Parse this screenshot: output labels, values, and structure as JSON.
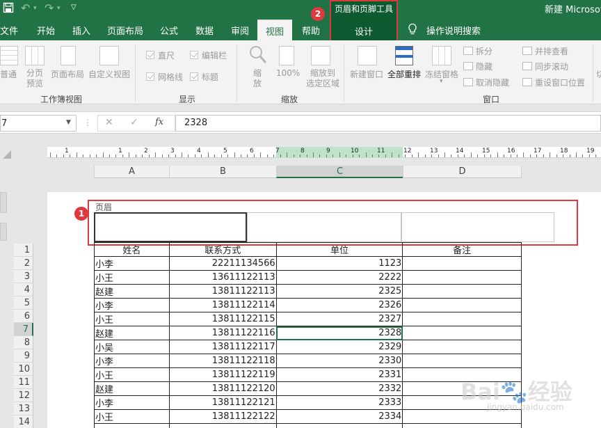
{
  "window": {
    "title": "新建 Microsof"
  },
  "quick_access": {
    "save_icon": "save-icon",
    "undo_icon": "undo-icon",
    "redo_icon": "redo-icon",
    "more": "▽"
  },
  "menu_tabs": [
    "文件",
    "开始",
    "插入",
    "页面布局",
    "公式",
    "数据",
    "审阅",
    "视图",
    "帮助"
  ],
  "active_tab": "视图",
  "context_group": {
    "title": "页眉和页脚工具",
    "tab": "设计"
  },
  "tell_me": {
    "text": "操作说明搜索",
    "icon": "lightbulb-icon"
  },
  "annotations": {
    "badge1": "1",
    "badge2": "2"
  },
  "ribbon": {
    "workbook_views": {
      "items": [
        "普通",
        "分页\n预览",
        "页面布局",
        "自定义视图"
      ],
      "name": "工作簿视图"
    },
    "show": {
      "items": [
        "直尺",
        "编辑栏",
        "网格线",
        "标题"
      ],
      "name": "显示"
    },
    "zoom": {
      "items": [
        "缩\n放",
        "100%",
        "缩放到\n选定区域"
      ],
      "name": "缩放"
    },
    "window": {
      "big": [
        "新建窗口",
        "全部重排",
        "冻结窗格"
      ],
      "small": [
        "拆分",
        "隐藏",
        "取消隐藏",
        "并排查看",
        "同步滚动",
        "重设窗口位置"
      ],
      "name": "窗口"
    },
    "cut_right": "切"
  },
  "formula_bar": {
    "name_box": "7",
    "fx": "fx",
    "cancel": "✕",
    "confirm": "✓",
    "formula": "2328"
  },
  "ruler_numbers": [
    "1",
    "1",
    "2",
    "3",
    "4",
    "5",
    "6",
    "7",
    "8",
    "9",
    "10",
    "11",
    "12",
    "13",
    "14",
    "15",
    "16",
    "17",
    "18",
    "19"
  ],
  "columns": [
    "A",
    "B",
    "C",
    "D"
  ],
  "header_section": {
    "label": "页眉"
  },
  "row_numbers": [
    "1",
    "2",
    "3",
    "4",
    "5",
    "6",
    "7",
    "8",
    "9",
    "10",
    "11",
    "12",
    "13",
    "14"
  ],
  "table": {
    "headers": [
      "姓名",
      "联系方式",
      "单位",
      "备注"
    ],
    "rows": [
      [
        "小李",
        "22211134566",
        "1123",
        ""
      ],
      [
        "小王",
        "13611122113",
        "2222",
        ""
      ],
      [
        "赵建",
        "13811122113",
        "2325",
        ""
      ],
      [
        "小李",
        "13811122114",
        "2326",
        ""
      ],
      [
        "小王",
        "13811122115",
        "2327",
        ""
      ],
      [
        "赵建",
        "13811122116",
        "2328",
        ""
      ],
      [
        "小吴",
        "13811122117",
        "2329",
        ""
      ],
      [
        "小李",
        "13811122118",
        "2330",
        ""
      ],
      [
        "小王",
        "13811122119",
        "2331",
        ""
      ],
      [
        "赵建",
        "13811122120",
        "2332",
        ""
      ],
      [
        "小李",
        "13811122121",
        "2333",
        ""
      ],
      [
        "小王",
        "13811122122",
        "2334",
        ""
      ]
    ]
  },
  "watermark": {
    "brand": "Bai",
    "brand2": "经验",
    "url": "jingyan.baidu.com"
  }
}
